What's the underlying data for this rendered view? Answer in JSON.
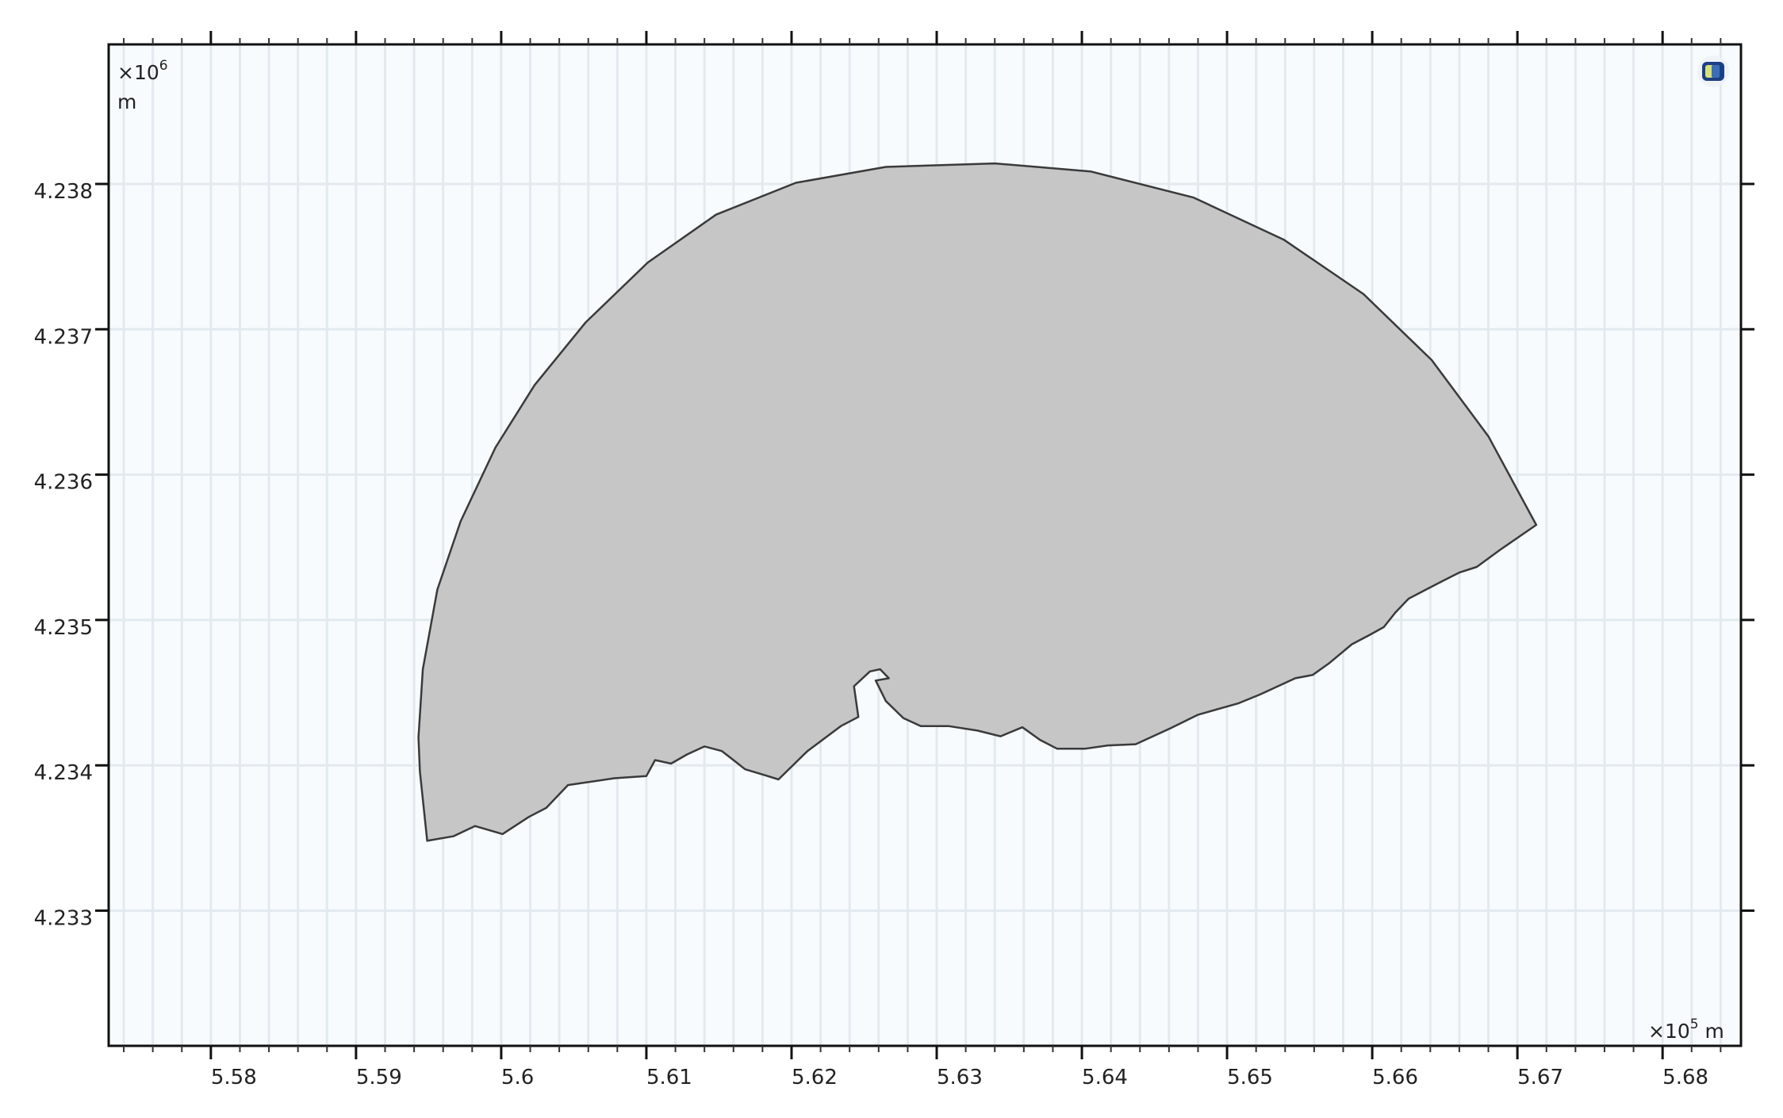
{
  "chart_data": {
    "type": "area",
    "title": "",
    "x_scale_label": "×10",
    "x_scale_exponent": "5",
    "x_unit": "m",
    "y_scale_label": "×10",
    "y_scale_exponent": "6",
    "y_unit": "m",
    "xlim": [
      5.57296,
      5.6854
    ],
    "ylim": [
      4.23207,
      4.23896
    ],
    "x_ticks": [
      5.58,
      5.59,
      5.6,
      5.61,
      5.62,
      5.63,
      5.64,
      5.65,
      5.66,
      5.67,
      5.68
    ],
    "x_tick_labels": [
      "5.58",
      "5.59",
      "5.6",
      "5.61",
      "5.62",
      "5.63",
      "5.64",
      "5.65",
      "5.66",
      "5.67",
      "5.68"
    ],
    "x_minor_step": 0.002,
    "y_ticks": [
      4.238,
      4.237,
      4.236,
      4.235,
      4.234,
      4.233
    ],
    "y_tick_labels": [
      "4.238",
      "4.237",
      "4.236",
      "4.235",
      "4.234",
      "4.233"
    ],
    "grid": true,
    "fill_color": "#c6c6c6",
    "edge_color": "#3a3a3a",
    "background_color": "#f7fbfe",
    "grid_color": "#e3eaef",
    "geometry_polygon": [
      [
        5.5949,
        4.233481
      ],
      [
        5.5944,
        4.233958
      ],
      [
        5.5943,
        4.234192
      ],
      [
        5.5946,
        4.234661
      ],
      [
        5.5956,
        4.235209
      ],
      [
        5.5972,
        4.235678
      ],
      [
        5.5996,
        4.236186
      ],
      [
        5.6023,
        4.236616
      ],
      [
        5.6058,
        4.237046
      ],
      [
        5.6101,
        4.23746
      ],
      [
        5.6148,
        4.237789
      ],
      [
        5.6203,
        4.238008
      ],
      [
        5.6265,
        4.238117
      ],
      [
        5.634,
        4.238141
      ],
      [
        5.6406,
        4.238086
      ],
      [
        5.6477,
        4.237906
      ],
      [
        5.6539,
        4.237617
      ],
      [
        5.6594,
        4.237242
      ],
      [
        5.6641,
        4.236788
      ],
      [
        5.668,
        4.236264
      ],
      [
        5.6713,
        4.235654
      ],
      [
        5.6688,
        4.235482
      ],
      [
        5.6672,
        4.235365
      ],
      [
        5.666,
        4.235326
      ],
      [
        5.6649,
        4.235271
      ],
      [
        5.6637,
        4.235209
      ],
      [
        5.6625,
        4.235146
      ],
      [
        5.6616,
        4.235052
      ],
      [
        5.6608,
        4.234951
      ],
      [
        5.6598,
        4.234896
      ],
      [
        5.6586,
        4.234833
      ],
      [
        5.657,
        4.2347
      ],
      [
        5.6559,
        4.234622
      ],
      [
        5.6547,
        4.234599
      ],
      [
        5.6523,
        4.234489
      ],
      [
        5.6508,
        4.234427
      ],
      [
        5.648,
        4.234348
      ],
      [
        5.6461,
        4.234255
      ],
      [
        5.6437,
        4.234145
      ],
      [
        5.6418,
        4.234137
      ],
      [
        5.6402,
        4.234114
      ],
      [
        5.6383,
        4.234114
      ],
      [
        5.6371,
        4.234176
      ],
      [
        5.6359,
        4.234262
      ],
      [
        5.6344,
        4.2342
      ],
      [
        5.6328,
        4.234239
      ],
      [
        5.6308,
        4.23427
      ],
      [
        5.6289,
        4.23427
      ],
      [
        5.6277,
        4.234325
      ],
      [
        5.6265,
        4.234442
      ],
      [
        5.6258,
        4.234583
      ],
      [
        5.6267,
        4.234599
      ],
      [
        5.6261,
        4.234661
      ],
      [
        5.6254,
        4.234646
      ],
      [
        5.6243,
        4.234544
      ],
      [
        5.6246,
        4.234333
      ],
      [
        5.6234,
        4.23427
      ],
      [
        5.6211,
        4.234098
      ],
      [
        5.6191,
        4.233903
      ],
      [
        5.6181,
        4.233934
      ],
      [
        5.6168,
        4.233973
      ],
      [
        5.616,
        4.234036
      ],
      [
        5.6152,
        4.234098
      ],
      [
        5.614,
        4.23413
      ],
      [
        5.6128,
        4.234075
      ],
      [
        5.6117,
        4.234012
      ],
      [
        5.6106,
        4.234036
      ],
      [
        5.61,
        4.233926
      ],
      [
        5.6078,
        4.233911
      ],
      [
        5.6046,
        4.233864
      ],
      [
        5.6031,
        4.233707
      ],
      [
        5.6019,
        4.233645
      ],
      [
        5.6001,
        4.233527
      ],
      [
        5.5982,
        4.233582
      ],
      [
        5.5967,
        4.233512
      ]
    ]
  },
  "toolbar": {
    "icon": "graphics-window-icon"
  }
}
